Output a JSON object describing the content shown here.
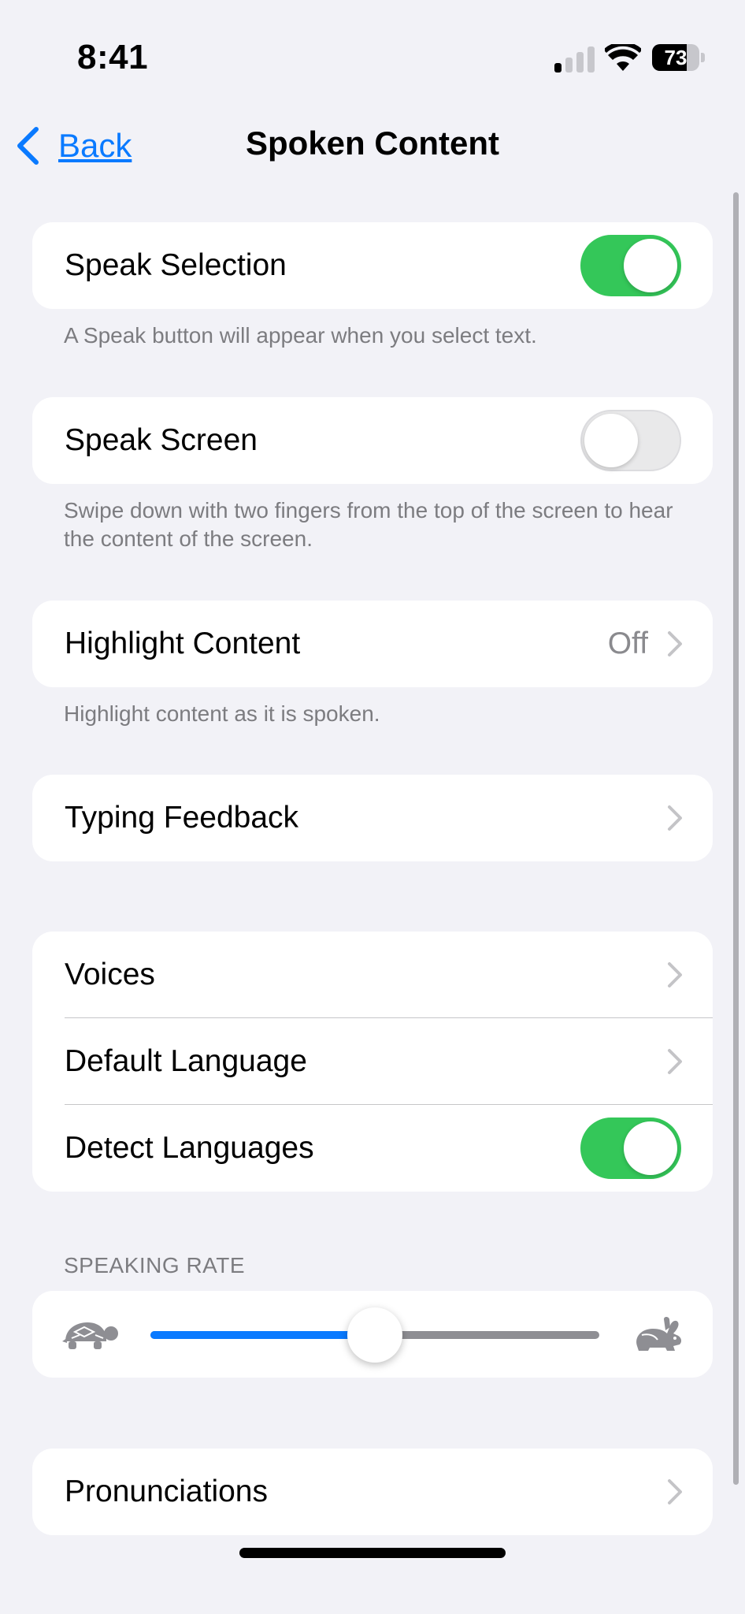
{
  "status_bar": {
    "time": "8:41",
    "battery_level": 73,
    "battery_text": "73",
    "signal_bars_active": 1,
    "signal_bars_total": 4
  },
  "nav": {
    "back_label": "Back",
    "title": "Spoken Content"
  },
  "speak_selection": {
    "label": "Speak Selection",
    "on": true,
    "footer": "A Speak button will appear when you select text."
  },
  "speak_screen": {
    "label": "Speak Screen",
    "on": false,
    "footer": "Swipe down with two fingers from the top of the screen to hear the content of the screen."
  },
  "highlight_content": {
    "label": "Highlight Content",
    "value": "Off",
    "footer": "Highlight content as it is spoken."
  },
  "typing_feedback": {
    "label": "Typing Feedback"
  },
  "voices_group": {
    "voices_label": "Voices",
    "default_language_label": "Default Language",
    "detect_languages_label": "Detect Languages",
    "detect_languages_on": true
  },
  "speaking_rate": {
    "header": "SPEAKING RATE",
    "value_fraction": 0.5,
    "min_icon": "turtle-icon",
    "max_icon": "rabbit-icon"
  },
  "pronunciations": {
    "label": "Pronunciations"
  },
  "colors": {
    "accent": "#0a7aff",
    "toggle_on": "#34c759",
    "slider_fill": "#0a7aff"
  }
}
